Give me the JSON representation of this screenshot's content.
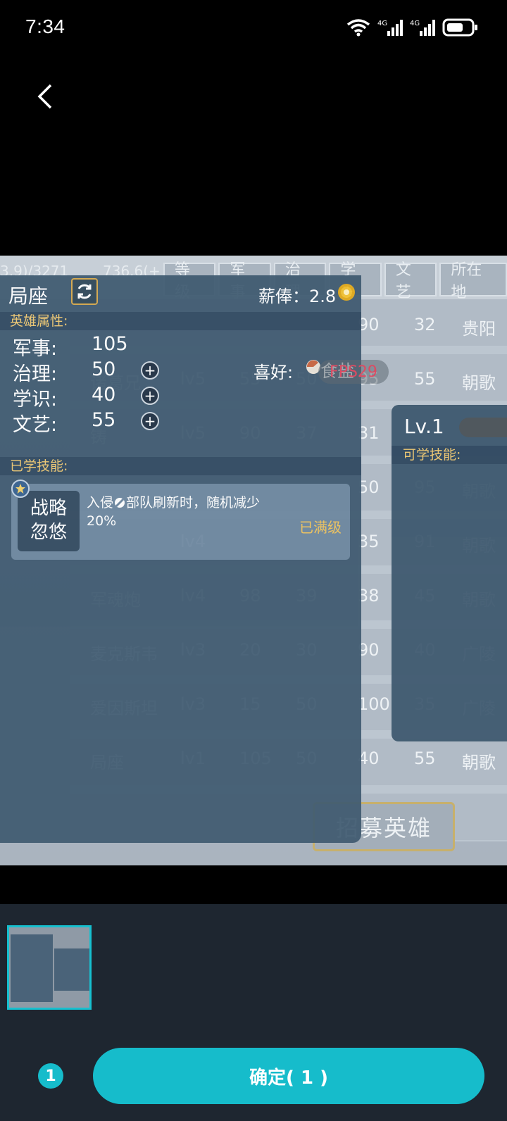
{
  "status_bar": {
    "time": "7:34",
    "network1": "4G",
    "network2": "4G"
  },
  "preview": {
    "bg_top_text": "3.9)/3271",
    "bg_top_text2": "736.6(+",
    "tabs": [
      "等级",
      "军事",
      "治理",
      "学识",
      "文艺",
      "所在地"
    ],
    "bg_rows": [
      {
        "c1": "",
        "c2": "",
        "c3": "",
        "c4": "",
        "c5": "90",
        "c6": "32",
        "c7": "贵阳"
      },
      {
        "c1": "诸葛兄",
        "c2": "lv5",
        "c3": "55",
        "c4": "50",
        "c5": "95",
        "c6": "55",
        "c7": "朝歌"
      },
      {
        "c1": "铸",
        "c2": "lv5",
        "c3": "90",
        "c4": "37",
        "c5": "31",
        "c6": "",
        "c7": ""
      },
      {
        "c1": "",
        "c2": "",
        "c3": "",
        "c4": "",
        "c5": "50",
        "c6": "95",
        "c7": "朝歌"
      },
      {
        "c1": "",
        "c2": "lv4",
        "c3": "",
        "c4": "",
        "c5": "35",
        "c6": "91",
        "c7": "朝歌"
      },
      {
        "c1": "军魂炮",
        "c2": "lv4",
        "c3": "98",
        "c4": "39",
        "c5": "38",
        "c6": "45",
        "c7": "朝歌"
      },
      {
        "c1": "麦克斯韦",
        "c2": "lv3",
        "c3": "20",
        "c4": "30",
        "c5": "90",
        "c6": "40",
        "c7": "广陵"
      },
      {
        "c1": "爱因斯坦",
        "c2": "lv3",
        "c3": "15",
        "c4": "50",
        "c5": "100",
        "c6": "35",
        "c7": "广陵"
      },
      {
        "c1": "局座",
        "c2": "lv1",
        "c3": "105",
        "c4": "50",
        "c5": "40",
        "c6": "55",
        "c7": "朝歌"
      }
    ],
    "recruit_button": "招募英雄",
    "dialog": {
      "title": "局座",
      "salary_label": "薪俸：2.8",
      "attr_section": "英雄属性:",
      "attrs": [
        {
          "label": "军事:",
          "value": "105"
        },
        {
          "label": "治理:",
          "value": "50"
        },
        {
          "label": "学识:",
          "value": "40"
        },
        {
          "label": "文艺:",
          "value": "55"
        }
      ],
      "hobby_label": "喜好:",
      "hobby_value": "食盐",
      "fps": "FPS29",
      "skill_section": "已学技能:",
      "skill": {
        "name_line1": "战略",
        "name_line2": "忽悠",
        "desc": "入侵",
        "desc2": "部队刷新时，随机减少",
        "desc3": "20%",
        "status": "已满级"
      }
    },
    "right_card": {
      "level": "Lv.1",
      "section": "可学技能:"
    }
  },
  "bottom": {
    "selected_count": "1",
    "confirm_label": "确定( 1 )"
  },
  "colors": {
    "accent": "#16bccb",
    "dialog": "#3f5a70",
    "gold": "#f2c45a"
  }
}
